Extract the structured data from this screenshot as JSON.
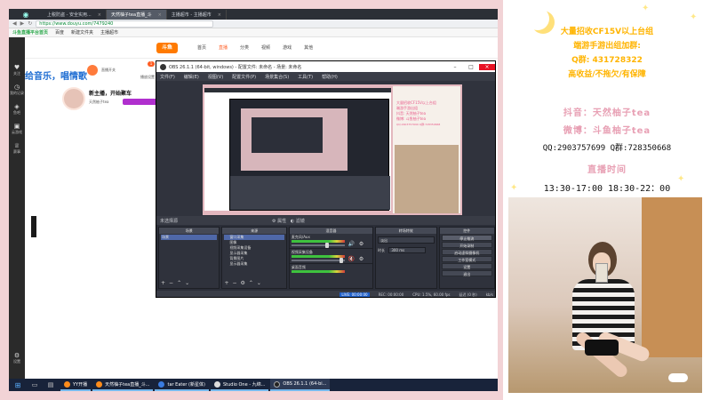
{
  "browser": {
    "tabs": [
      "上税防盗 - 安全实用...",
      "天然柚子tea直播_斗",
      "主播超市 - 主播超市"
    ],
    "address": "https://www.douyu.com/7479240",
    "bookmarks": [
      "斗鱼直播平台首页",
      "百度",
      "新建文件夹",
      "主播超市"
    ]
  },
  "douyu": {
    "logo": "斗鱼",
    "nav": [
      "首页",
      "直播",
      "分类",
      "视频",
      "游戏",
      "其他"
    ],
    "sidebar": [
      {
        "icon": "heart-icon",
        "glyph": "♥",
        "label": "关注"
      },
      {
        "icon": "clock-icon",
        "glyph": "◷",
        "label": "我的记录"
      },
      {
        "icon": "shield-icon",
        "glyph": "◈",
        "label": "鱼吧"
      },
      {
        "icon": "cart-icon",
        "glyph": "▣",
        "label": "云游戏"
      },
      {
        "icon": "trophy-icon",
        "glyph": "♕",
        "label": "赛事"
      },
      {
        "icon": "gear-icon",
        "glyph": "⚙",
        "label": "设置"
      }
    ],
    "ticker": "给音乐，唱情歌",
    "strip": {
      "live_label": "直播开关",
      "count": "1",
      "guide_label": "播放设置"
    },
    "anchor": {
      "title": "新主播，开始聚车",
      "name": "天然柚子tea"
    }
  },
  "obs": {
    "title": "OBS 26.1.1 (64-bit, windows) - 配置文件: 未命名 - 场景: 未命名",
    "menu": [
      "文件(F)",
      "编辑(E)",
      "视图(V)",
      "配置文件(P)",
      "场景集合(S)",
      "工具(T)",
      "帮助(H)"
    ],
    "status_source": "未选择源",
    "status_props": "属性",
    "status_filters": "滤镜",
    "docks": {
      "scenes": {
        "title": "场景",
        "items": [
          "场景"
        ]
      },
      "sources": {
        "title": "来源",
        "items": [
          "窗口采集",
          "图像",
          "视频采集设备",
          "显示器采集",
          "背景图片",
          "显示器采集"
        ]
      },
      "mixer": {
        "title": "混音器",
        "rows": [
          {
            "label": "麦克风/Aux",
            "muted": false
          },
          {
            "label": "视频采集设备",
            "muted": true
          },
          {
            "label": "桌面音频",
            "muted": false
          }
        ]
      },
      "transitions": {
        "title": "转场特效",
        "type": "淡出",
        "duration_label": "时长",
        "duration": "300 ms"
      },
      "controls": {
        "title": "控件",
        "buttons": [
          "停止推流",
          "开始录制",
          "启动虚拟摄像机",
          "工作室模式",
          "设置",
          "退出"
        ]
      }
    },
    "statusbar": {
      "live": "LIVE: 00:00:00",
      "rec": "REC: 00:00:00",
      "cpu": "CPU: 1.5%, 60.00 fps",
      "delay": "延迟 (0 秒)",
      "kbps": "kb/s"
    },
    "preview_side": [
      "大量招收CF15V以上台组",
      "端游手游出组",
      "抖音: 天然柚子tea",
      "微博: 斗鱼柚子tea",
      "QQ:2903757699 Q群:728350668"
    ]
  },
  "taskbar": {
    "items": [
      "YY开播",
      "天然柚子tea直播_斗...",
      "tar Eater (新星体)",
      "Studio One - 九绵...",
      "OBS 26.1.1 (64-bi..."
    ]
  },
  "overlay": {
    "line1": "大量招收CF15V以上台组",
    "line2": "端游手游出组加群:",
    "line3": "Q群: 431728322",
    "line4": "高收益/不拖欠/有保障",
    "line5": "抖音：天然柚子tea",
    "line6": "微博：斗鱼柚子tea",
    "line7": "QQ:2903757699 Q群:728350668",
    "line8": "直播时间",
    "line9": "13:30-17:00   18:30-22：00"
  }
}
